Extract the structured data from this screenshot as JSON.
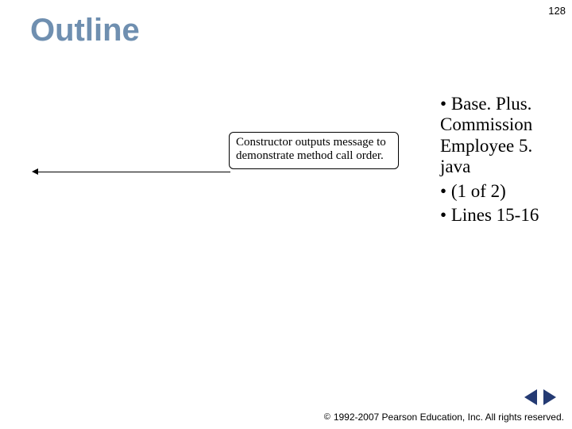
{
  "page_number": "128",
  "title": "Outline",
  "callout": {
    "text": "Constructor outputs message to demonstrate method call order."
  },
  "bullets": {
    "item1": "Base. Plus. Commission Employee 5. java",
    "item2": "(1 of 2)",
    "item3": "Lines 15-16"
  },
  "footer": {
    "copyright_symbol": "©",
    "text": "1992-2007 Pearson Education, Inc.  All rights reserved."
  }
}
